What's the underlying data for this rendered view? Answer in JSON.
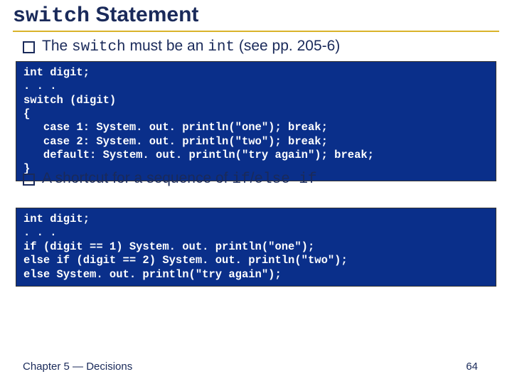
{
  "title": {
    "mono": "switch",
    "rest": " Statement"
  },
  "bullet1": {
    "pre": "The ",
    "mono1": "switch",
    "mid": " must be an ",
    "mono2": "int",
    "post": " (see pp. 205-6)"
  },
  "code1": "int digit;\n. . .\nswitch (digit)\n{\n   case 1: System. out. println(\"one\"); break;\n   case 2: System. out. println(\"two\"); break;\n   default: System. out. println(\"try again\"); break;\n}",
  "bullet2": {
    "pre": "A shortcut for a sequence of ",
    "mono1": "if",
    "mid": "/",
    "mono2": "else if"
  },
  "code2": "int digit;\n. . .\nif (digit == 1) System. out. println(\"one\");\nelse if (digit == 2) System. out. println(\"two\");\nelse System. out. println(\"try again\");",
  "footer": {
    "left": "Chapter 5 — Decisions",
    "right": "64"
  }
}
